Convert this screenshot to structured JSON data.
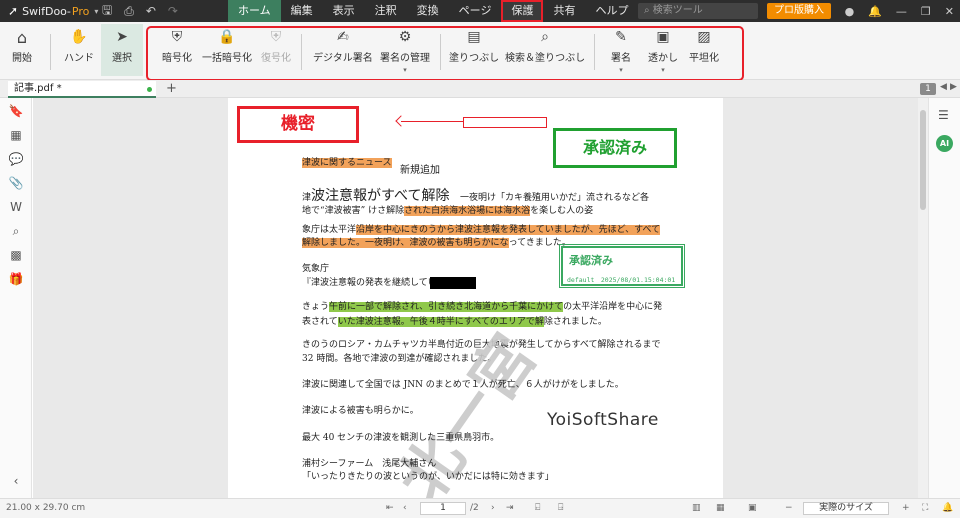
{
  "app": {
    "name": "SwifDoo",
    "name_suffix": "Pro",
    "dropdown_caret": "▾"
  },
  "title_icons": [
    "save-icon",
    "print-icon",
    "undo-icon",
    "redo-icon"
  ],
  "menu_tabs": [
    {
      "label": "ホーム",
      "state": "active"
    },
    {
      "label": "編集",
      "state": ""
    },
    {
      "label": "表示",
      "state": ""
    },
    {
      "label": "注釈",
      "state": ""
    },
    {
      "label": "変換",
      "state": ""
    },
    {
      "label": "ページ",
      "state": ""
    },
    {
      "label": "保護",
      "state": "selected"
    },
    {
      "label": "共有",
      "state": ""
    },
    {
      "label": "ヘルプ",
      "state": ""
    }
  ],
  "search": {
    "placeholder": "検索ツール"
  },
  "buy_pro_label": "プロ版購入",
  "ribbon": {
    "start": "開始",
    "hand": "ハンド",
    "select": "選択",
    "encrypt": "暗号化",
    "batch_encrypt": "一括暗号化",
    "decrypt": "復号化",
    "digital_sign": "デジタル署名",
    "sign_manage": "署名の管理",
    "redact": "塗りつぶし",
    "search_redact": "検索＆塗りつぶし",
    "sign": "署名",
    "watermark": "透かし",
    "flatten": "平坦化"
  },
  "document_tab": {
    "label": "記事.pdf *",
    "add": "+"
  },
  "page_indicator_badge": "1",
  "document": {
    "stamp_confidential": "機密",
    "stamp_approved": "承認済み",
    "stamp_approved_small": "承認済み",
    "stamp_meta": "default　2025/08/01.15:04:01",
    "line_tag": "津波に関するニュース",
    "added_text": "新規追加",
    "title_prefix": "津",
    "title": "波注意報がすべて解除",
    "title_after": "一夜明け「カキ養殖用いかだ」流されるなど各",
    "p1_l2_a": "地で“津波被害” けさ解除",
    "p1_l2_hl": "された白浜海水浴場には海水浴",
    "p1_l2_b": "を楽しむ人の姿",
    "p2_l1_a": "象庁は太平洋",
    "p2_l1_hl": "沿岸を中心にきのうから津波注意報を発表していましたが、先ほど、すべて",
    "p2_l2_hl": "解除しました。一夜明け、津波の被害も明らかにな",
    "p2_l2_b": "ってきました。",
    "p3_l1": "気象庁",
    "p3_l2": "『津波注意報の発表を継続してい",
    "p4_l1_a": "きょう",
    "p4_l1_hl": "午前に一部で解除され、引き続き北海道から千葉にかけて",
    "p4_l1_b": "の太平洋沿岸を中心に発",
    "p4_l2_a": "表されて",
    "p4_l2_hl": "いた津波注意報。午後４時半にすべてのエリアで解",
    "p4_l2_b": "除されました。",
    "p5_l1": "きのうのロシア・カムチャツカ半島付近の巨大地震が発生してからすべて解除されるまで",
    "p5_l2": "32 時間。各地で津波の到達が確認されました。",
    "p6": "津波に関連して全国では JNN のまとめで１人が死亡、６人がけがをしました。",
    "p7": "津波による被害も明らかに。",
    "p8": "最大 40 センチの津波を観測した三重県鳥羽市。",
    "p9_l1": "浦村シーファーム　浅尾大輔さん",
    "p9_l2": "「いったりきたりの波というのが、いかだには特に効きます」",
    "signature": "YoiSoftShare",
    "watermark_text": "北一宮"
  },
  "status": {
    "page_size": "21.00 x 29.70 cm",
    "current_page": "1",
    "total_pages": "/2",
    "zoom_label": "実際のサイズ"
  }
}
